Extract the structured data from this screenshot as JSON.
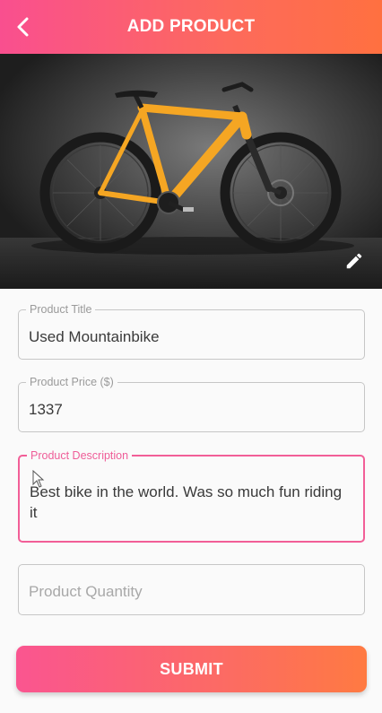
{
  "appbar": {
    "title": "ADD PRODUCT",
    "back_icon": "chevron-left-icon",
    "background_gradient": [
      "#f94f8f",
      "#ff7040"
    ]
  },
  "hero": {
    "image_subject": "orange mountain bike on dark grey background",
    "edit_icon": "pencil-icon"
  },
  "form": {
    "title": {
      "label": "Product Title",
      "value": "Used Mountainbike"
    },
    "price": {
      "label": "Product Price ($)",
      "value": "1337"
    },
    "description": {
      "label": "Product Description",
      "value": "Best bike in the world. Was so much fun riding it",
      "focused": true
    },
    "quantity": {
      "placeholder": "Product Quantity",
      "value": ""
    }
  },
  "submit": {
    "label": "SUBMIT"
  },
  "colors": {
    "accent": "#f25e97",
    "bike_frame": "#f5a623",
    "field_border": "#c6c6c6"
  }
}
